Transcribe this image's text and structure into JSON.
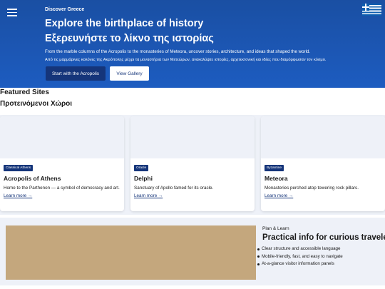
{
  "header": {
    "site_name": "Discover Greece",
    "menu_icon": "hamburger-icon",
    "flag_icon": "greek-flag-icon"
  },
  "hero": {
    "title_en": "Explore the birthplace of history",
    "title_gr": "Εξερευνήστε το λίκνο της ιστορίας",
    "description_en": "From the marble columns of the Acropolis to the monasteries of Meteora, uncover stories, architecture, and ideas that shaped the world.",
    "description_gr": "Από τις μαρμάρινες κολόνες της Ακρόπολης μέχρι τα μοναστήρια των Μετεώρων, ανακαλύψτε ιστορίες, αρχιτεκτονική και ιδέες που διαμόρφωσαν τον κόσμο.",
    "primary_button": "Start with the Acropolis",
    "secondary_button": "View Gallery"
  },
  "featured": {
    "title_en": "Featured Sites",
    "title_gr": "Προτεινόμενοι Χώροι",
    "cards": [
      {
        "tag": "Classical Athens",
        "name": "Acropolis of Athens",
        "text": "Home to the Parthenon — a symbol of democracy and art.",
        "link": "Learn more →"
      },
      {
        "tag": "Oracle",
        "name": "Delphi",
        "text": "Sanctuary of Apollo famed for its oracle.",
        "link": "Learn more →"
      },
      {
        "tag": "Byzantine",
        "name": "Meteora",
        "text": "Monasteries perched atop towering rock pillars.",
        "link": "Learn more →"
      }
    ]
  },
  "practical": {
    "eyebrow": "Plan & Learn",
    "title": "Practical info for curious travelers",
    "items": [
      "Clear structure and accessible language",
      "Mobile-friendly, fast, and easy to navigate",
      "At-a-glance visitor information panels"
    ]
  },
  "colors": {
    "hero_blue": "#1a4fa3",
    "button_navy": "#15357a",
    "section_bg": "#eef1f8",
    "photo_tan": "#c4a77d"
  }
}
